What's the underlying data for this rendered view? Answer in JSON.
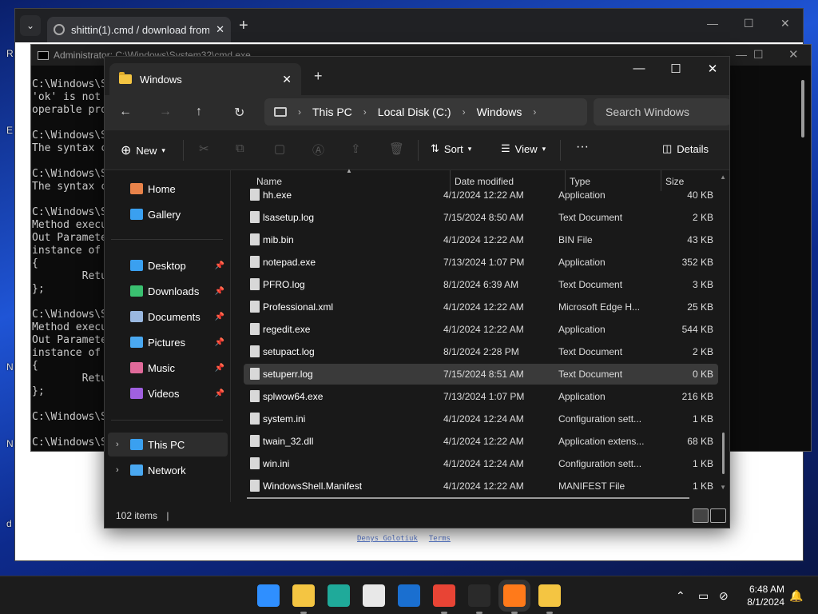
{
  "desktop": {
    "edge_labels": [
      "R",
      "E",
      "N",
      "N",
      "d"
    ]
  },
  "browser": {
    "tab_title": "shittin(1).cmd / download from",
    "new_tab": "+",
    "dropdown": "⌄",
    "footer_links": [
      "Denys Golotiuk",
      "Terms"
    ]
  },
  "cmd": {
    "title": "Administrator: C:\\Windows\\System32\\cmd.exe",
    "lines": [
      "C:\\Windows\\S",
      "'ok' is not",
      "operable pro",
      "",
      "C:\\Windows\\S",
      "The syntax c",
      "",
      "C:\\Windows\\S",
      "The syntax c",
      "",
      "C:\\Windows\\S",
      "Method execu",
      "Out Paramete",
      "instance of",
      "{",
      "        Retu",
      "};",
      "",
      "C:\\Windows\\S",
      "Method execu",
      "Out Paramete",
      "instance of",
      "{",
      "        Retu",
      "};",
      "",
      "C:\\Windows\\S",
      "",
      "C:\\Windows\\S"
    ]
  },
  "explorer": {
    "tab_title": "Windows",
    "breadcrumb": [
      "This PC",
      "Local Disk (C:)",
      "Windows"
    ],
    "search_placeholder": "Search Windows",
    "toolbar": {
      "new": "New",
      "sort": "Sort",
      "view": "View",
      "more": "···",
      "details": "Details"
    },
    "nav": {
      "home": "Home",
      "gallery": "Gallery",
      "quick": [
        {
          "label": "Desktop",
          "color": "#3aa0f0"
        },
        {
          "label": "Downloads",
          "color": "#3ac070"
        },
        {
          "label": "Documents",
          "color": "#9ab8e0"
        },
        {
          "label": "Pictures",
          "color": "#4aa8f0"
        },
        {
          "label": "Music",
          "color": "#e06a9a"
        },
        {
          "label": "Videos",
          "color": "#a060e0"
        }
      ],
      "this_pc": "This PC",
      "network": "Network"
    },
    "columns": {
      "name": "Name",
      "date": "Date modified",
      "type": "Type",
      "size": "Size"
    },
    "files": [
      {
        "name": "hh.exe",
        "date": "4/1/2024 12:22 AM",
        "type": "Application",
        "size": "40 KB"
      },
      {
        "name": "lsasetup.log",
        "date": "7/15/2024 8:50 AM",
        "type": "Text Document",
        "size": "2 KB"
      },
      {
        "name": "mib.bin",
        "date": "4/1/2024 12:22 AM",
        "type": "BIN File",
        "size": "43 KB"
      },
      {
        "name": "notepad.exe",
        "date": "7/13/2024 1:07 PM",
        "type": "Application",
        "size": "352 KB"
      },
      {
        "name": "PFRO.log",
        "date": "8/1/2024 6:39 AM",
        "type": "Text Document",
        "size": "3 KB"
      },
      {
        "name": "Professional.xml",
        "date": "4/1/2024 12:22 AM",
        "type": "Microsoft Edge H...",
        "size": "25 KB"
      },
      {
        "name": "regedit.exe",
        "date": "4/1/2024 12:22 AM",
        "type": "Application",
        "size": "544 KB"
      },
      {
        "name": "setupact.log",
        "date": "8/1/2024 2:28 PM",
        "type": "Text Document",
        "size": "2 KB"
      },
      {
        "name": "setuperr.log",
        "date": "7/15/2024 8:51 AM",
        "type": "Text Document",
        "size": "0 KB"
      },
      {
        "name": "splwow64.exe",
        "date": "7/13/2024 1:07 PM",
        "type": "Application",
        "size": "216 KB"
      },
      {
        "name": "system.ini",
        "date": "4/1/2024 12:24 AM",
        "type": "Configuration sett...",
        "size": "1 KB"
      },
      {
        "name": "twain_32.dll",
        "date": "4/1/2024 12:22 AM",
        "type": "Application extens...",
        "size": "68 KB"
      },
      {
        "name": "win.ini",
        "date": "4/1/2024 12:24 AM",
        "type": "Configuration sett...",
        "size": "1 KB"
      },
      {
        "name": "WindowsShell.Manifest",
        "date": "4/1/2024 12:22 AM",
        "type": "MANIFEST File",
        "size": "1 KB"
      }
    ],
    "selected_file": "setuperr.log",
    "status": "102 items"
  },
  "taskbar": {
    "apps": [
      {
        "name": "start",
        "color": "#2f8fff"
      },
      {
        "name": "file-explorer",
        "color": "#f4c542"
      },
      {
        "name": "edge",
        "color": "#1faa9a"
      },
      {
        "name": "store",
        "color": "#e8e8e8"
      },
      {
        "name": "outlook",
        "color": "#1a6fd0"
      },
      {
        "name": "chrome",
        "color": "#e84435"
      },
      {
        "name": "terminal",
        "color": "#2a2a2a"
      },
      {
        "name": "firefox",
        "color": "#ff7a1a"
      },
      {
        "name": "explorer-2",
        "color": "#f4c542"
      }
    ],
    "time": "6:48 AM",
    "date": "8/1/2024"
  },
  "colors": {
    "selection": "#3a3a3a",
    "explorer_bg": "#191919",
    "accent": "#60cdff"
  }
}
